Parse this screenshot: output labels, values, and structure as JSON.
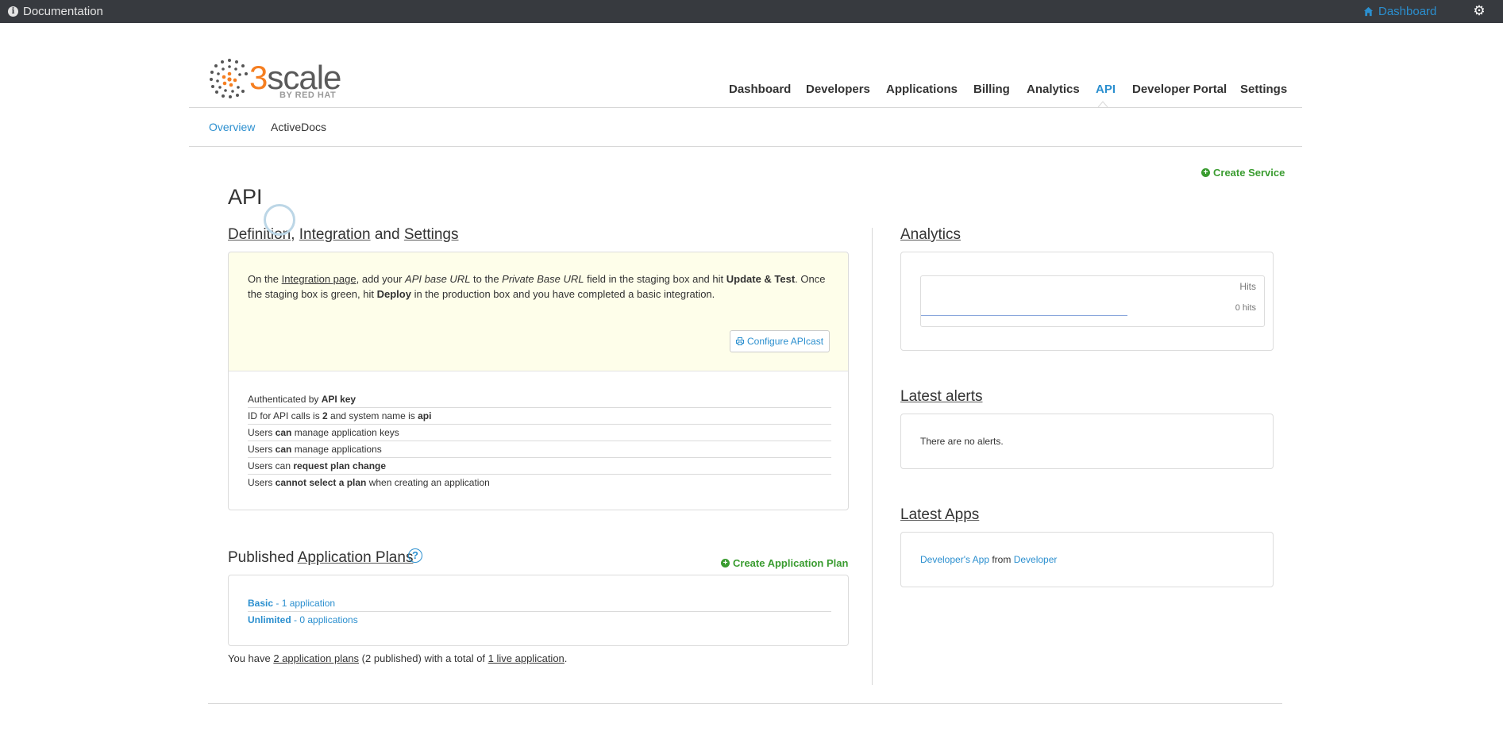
{
  "topbar": {
    "documentation": "Documentation",
    "dashboard": "Dashboard"
  },
  "logo": {
    "three": "3",
    "scale": "scale",
    "by": "BY RED HAT"
  },
  "nav": {
    "items": [
      "Dashboard",
      "Developers",
      "Applications",
      "Billing",
      "Analytics",
      "API",
      "Developer Portal",
      "Settings"
    ],
    "active": "API"
  },
  "subnav": {
    "overview": "Overview",
    "activedocs": "ActiveDocs"
  },
  "create_service": "Create Service",
  "page_title": "API",
  "integration": {
    "title_link1": "Definition",
    "sep1": ",",
    "title_link2": "Integration",
    "sep2": "and",
    "title_link3": "Settings",
    "text_a": "On the ",
    "text_link": "Integration page",
    "text_b": ", add your ",
    "text_em1": "API base URL",
    "text_c": " to the ",
    "text_em2": "Private Base URL",
    "text_d": " field in the staging box and hit ",
    "text_strong1": "Update & Test",
    "text_e": ". Once the staging box is green, hit ",
    "text_strong2": "Deploy",
    "text_f": " in the production box and you have completed a basic integration.",
    "configure_button": "Configure APIcast"
  },
  "facts": {
    "f1a": "Authenticated by ",
    "f1b": "API key",
    "f2a": "ID for API calls is ",
    "f2b": "2",
    "f2c": " and system name is ",
    "f2d": "api",
    "f3a": "Users ",
    "f3b": "can",
    "f3c": " manage application keys",
    "f4a": "Users ",
    "f4b": "can",
    "f4c": " manage applications",
    "f5a": "Users can ",
    "f5b": "request plan change",
    "f6a": "Users ",
    "f6b": "cannot select a plan",
    "f6c": " when creating an application"
  },
  "plans": {
    "title_prefix": "Published",
    "title_link": "Application Plans",
    "help": "?",
    "create": "Create Application Plan",
    "p1_name": "Basic",
    "p1_rest": " - 1 application",
    "p2_name": "Unlimited",
    "p2_rest": " - 0 applications",
    "summary_a": "You have ",
    "summary_link1": "2 application plans",
    "summary_b": " (2 published) with a total of ",
    "summary_link2": "1 live application",
    "summary_c": "."
  },
  "analytics": {
    "title": "Analytics",
    "hits_label": "Hits",
    "hits_value": "0 hits"
  },
  "alerts": {
    "title": "Latest alerts",
    "empty": "There are no alerts."
  },
  "apps": {
    "title": "Latest Apps",
    "app_name": "Developer's App",
    "from": " from ",
    "owner": "Developer"
  },
  "colors": {
    "accent": "#2b8fcf",
    "green": "#3a9c30",
    "topbar": "#373a3f",
    "highlight_bg": "#fefeea",
    "brand_orange": "#f57e20"
  }
}
